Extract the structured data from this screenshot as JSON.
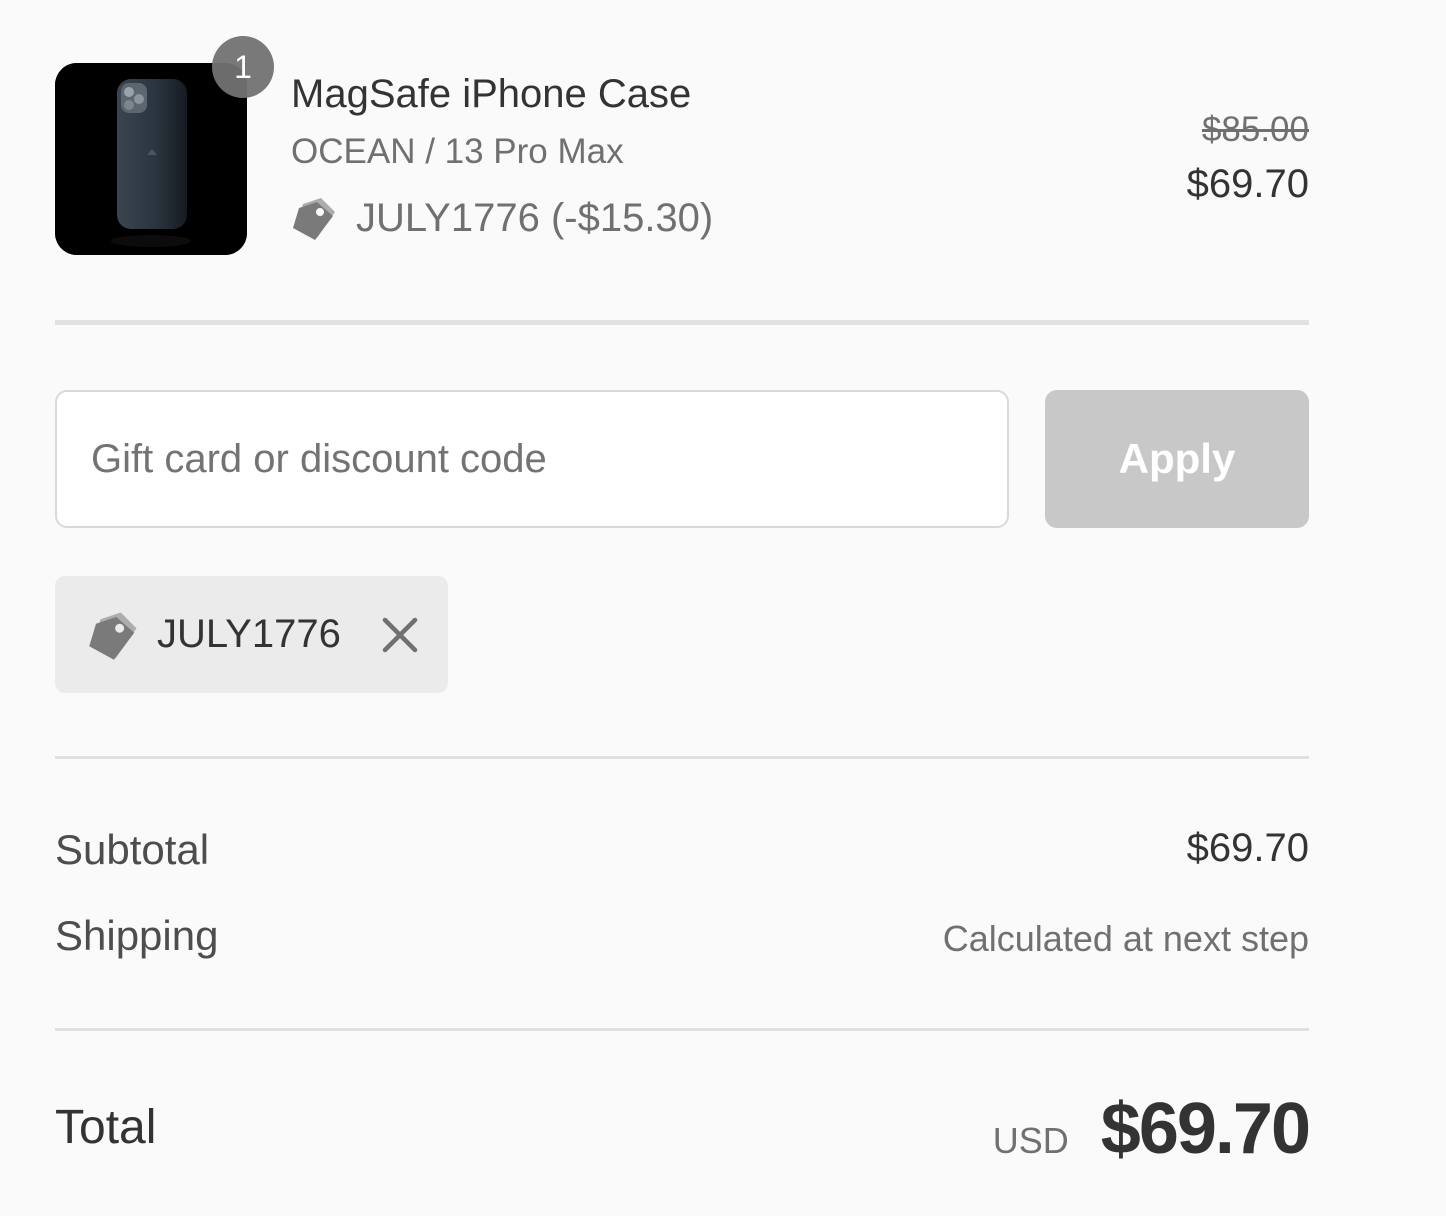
{
  "order_summary": {
    "product": {
      "name": "MagSafe iPhone Case",
      "variant": "OCEAN / 13 Pro Max",
      "quantity": "1",
      "discount_line": "JULY1776 (-$15.30)",
      "price_original": "$85.00",
      "price_final": "$69.70",
      "image_icon": "phone-case-image"
    },
    "discount_form": {
      "input_placeholder": "Gift card or discount code",
      "input_value": "",
      "apply_label": "Apply",
      "apply_disabled": true
    },
    "applied_code": {
      "label": "JULY1776",
      "remove_icon": "close-icon",
      "tag_icon": "price-tag-icon"
    },
    "lines": {
      "subtotal_label": "Subtotal",
      "subtotal_value": "$69.70",
      "shipping_label": "Shipping",
      "shipping_value": "Calculated at next step"
    },
    "total": {
      "label": "Total",
      "currency": "USD",
      "value": "$69.70"
    }
  },
  "colors": {
    "background": "#fafafa",
    "text": "#333333",
    "muted": "#707070",
    "button_disabled": "#c8c8c8",
    "chip_background": "#ebebeb",
    "divider": "#e1e1e1"
  }
}
